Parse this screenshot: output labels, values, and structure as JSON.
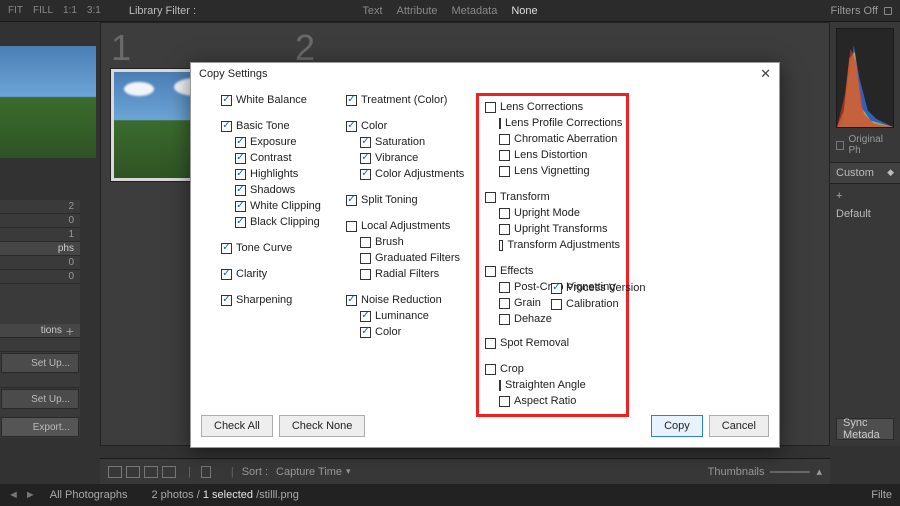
{
  "topbar": {
    "fit_label": "FIT",
    "fill_label": "FILL",
    "ratio_a": "1:1",
    "ratio_b": "3:1",
    "library_filter": "Library Filter :",
    "tabs": {
      "text": "Text",
      "attribute": "Attribute",
      "metadata": "Metadata",
      "none": "None"
    },
    "filters_off": "Filters Off"
  },
  "thumbs": {
    "n1": "1",
    "n2": "2"
  },
  "left_panel": {
    "counts": [
      "2",
      "0",
      "1",
      "0",
      "0"
    ],
    "phs": "phs",
    "tions": "tions",
    "setup1": "Set Up...",
    "setup2": "Set Up...",
    "export": "Export..."
  },
  "right_panel": {
    "original_ph": "Original Ph",
    "custom": "Custom",
    "plus": "+",
    "default": "Default",
    "sync": "Sync Metada"
  },
  "bottom": {
    "sort_label": "Sort :",
    "sort_value": "Capture Time",
    "thumbnails": "Thumbnails"
  },
  "status": {
    "all_photos": "All Photographs",
    "count": "2 photos /",
    "selected": "1 selected",
    "slash": "/",
    "filename": "stilll.png",
    "filter_tag": "Filte"
  },
  "dialog": {
    "title": "Copy Settings",
    "close": "✕",
    "check_all": "Check All",
    "check_none": "Check None",
    "copy": "Copy",
    "cancel": "Cancel",
    "col1": {
      "white_balance": "White Balance",
      "basic_tone": "Basic Tone",
      "exposure": "Exposure",
      "contrast": "Contrast",
      "highlights": "Highlights",
      "shadows": "Shadows",
      "white_clip": "White Clipping",
      "black_clip": "Black Clipping",
      "tone_curve": "Tone Curve",
      "clarity": "Clarity",
      "sharpening": "Sharpening"
    },
    "col2": {
      "treatment": "Treatment (Color)",
      "color": "Color",
      "saturation": "Saturation",
      "vibrance": "Vibrance",
      "color_adj": "Color Adjustments",
      "split_toning": "Split Toning",
      "local_adj": "Local Adjustments",
      "brush": "Brush",
      "grad_filters": "Graduated Filters",
      "rad_filters": "Radial Filters",
      "noise_red": "Noise Reduction",
      "luminance": "Luminance",
      "color2": "Color"
    },
    "col3": {
      "lens_corr": "Lens Corrections",
      "lens_profile": "Lens Profile Corrections",
      "chrom_ab": "Chromatic Aberration",
      "lens_dist": "Lens Distortion",
      "lens_vig": "Lens Vignetting",
      "transform": "Transform",
      "upright_mode": "Upright Mode",
      "upright_trans": "Upright Transforms",
      "trans_adj": "Transform Adjustments",
      "effects": "Effects",
      "pcv": "Post-Crop Vignetting",
      "grain": "Grain",
      "dehaze": "Dehaze"
    },
    "col4": {
      "spot_removal": "Spot Removal",
      "crop": "Crop",
      "straighten": "Straighten Angle",
      "aspect": "Aspect Ratio"
    },
    "below": {
      "process_version": "Process Version",
      "calibration": "Calibration"
    }
  }
}
